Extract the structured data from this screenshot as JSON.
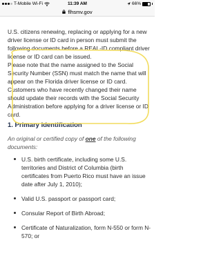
{
  "status_bar": {
    "carrier": "T-Mobile Wi-Fi",
    "time": "11:39 AM",
    "battery": "66%",
    "battery_level": 0.66
  },
  "url_bar": {
    "domain": "flhsmv.gov"
  },
  "article": {
    "paragraph_1": "U.S. citizens renewing, replacing or applying for a new driver license or ID card in person must submit the following documents before a REAL-ID compliant driver license or ID card can be issued.",
    "paragraph_2": "Please note that the name assigned to the Social Security Number (SSN) must match the name that will appear on the Florida driver license or ID card. Customers who have recently changed their name should update their records with the Social Security Administration before applying for a driver license or ID card.",
    "section_heading": "1. Primary Identification",
    "intro_before": "An original or certified copy of ",
    "intro_emphasis": "one",
    "intro_after": " of the following documents:",
    "documents": [
      "U.S. birth certificate, including some U.S. territories and District of Columbia (birth certificates from Puerto Rico must have an issue date after July 1, 2010);",
      "Valid U.S. passport or passport card;",
      "Consular Report of Birth Abroad;",
      "Certificate of Naturalization, form N-550 or form N-570; or"
    ]
  },
  "colors": {
    "highlight_stroke": "#f2dc5d",
    "heading": "#1d2c4a",
    "body_text": "#2b2b2b"
  }
}
